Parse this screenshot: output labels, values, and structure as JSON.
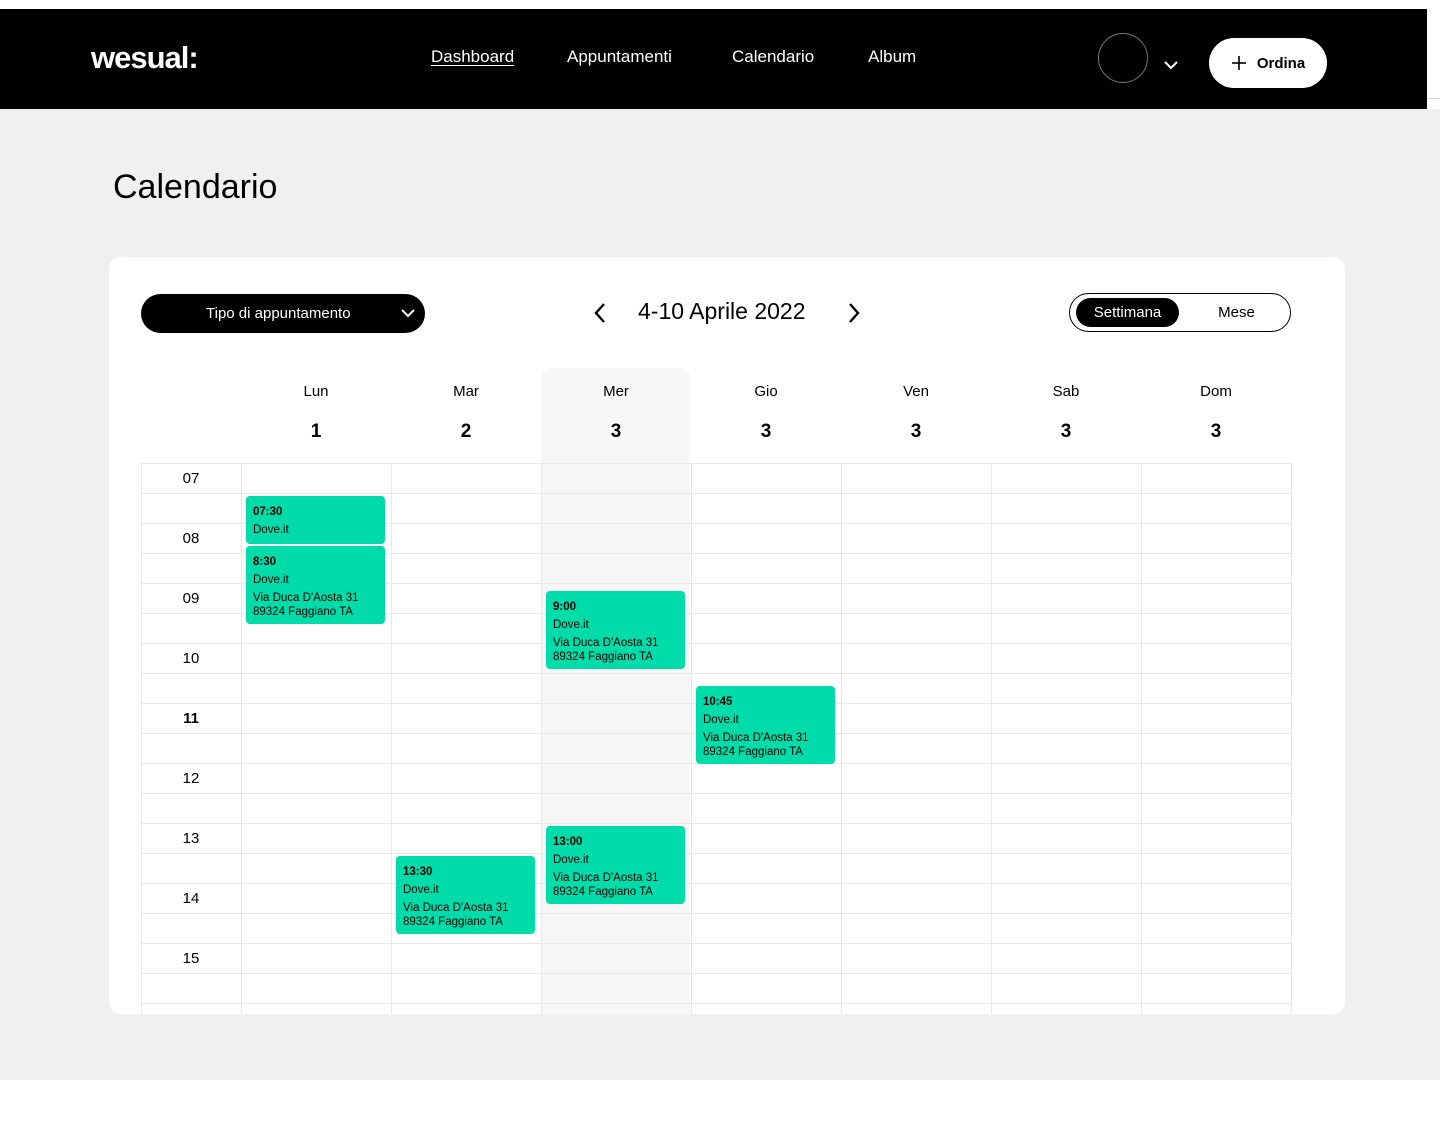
{
  "app": {
    "logo": "wesual:",
    "nav": [
      {
        "label": "Dashboard",
        "active": true
      },
      {
        "label": "Appuntamenti",
        "active": false
      },
      {
        "label": "Calendario",
        "active": false
      },
      {
        "label": "Album",
        "active": false
      }
    ],
    "order_label": "Ordina",
    "accent": "#00dca9"
  },
  "page": {
    "title": "Calendario"
  },
  "toolbar": {
    "type_select": "Tipo di appuntamento",
    "week_label": "4-10 Aprile 2022",
    "view_week": "Settimana",
    "view_month": "Mese"
  },
  "days": [
    {
      "name": "Lun",
      "num": "1"
    },
    {
      "name": "Mar",
      "num": "2"
    },
    {
      "name": "Mer",
      "num": "3",
      "today": true
    },
    {
      "name": "Gio",
      "num": "3"
    },
    {
      "name": "Ven",
      "num": "3"
    },
    {
      "name": "Sab",
      "num": "3"
    },
    {
      "name": "Dom",
      "num": "3"
    }
  ],
  "hours": [
    "07",
    "08",
    "09",
    "10",
    "11",
    "12",
    "13",
    "14",
    "15"
  ],
  "events": [
    {
      "day": 0,
      "start": "07:30",
      "end": "08:20",
      "time": "07:30",
      "place": "Dove.it",
      "address": ""
    },
    {
      "day": 0,
      "start": "08:20",
      "end": "09:40",
      "time": "8:30",
      "place": "Dove.it",
      "address": "Via Duca D'Aosta 31 89324 Faggiano TA"
    },
    {
      "day": 2,
      "start": "09:05",
      "end": "10:25",
      "time": "9:00",
      "place": "Dove.it",
      "address": "Via Duca D'Aosta 31 89324 Faggiano TA"
    },
    {
      "day": 3,
      "start": "10:40",
      "end": "12:00",
      "time": "10:45",
      "place": "Dove.it",
      "address": "Via Duca D'Aosta 31 89324 Faggiano TA"
    },
    {
      "day": 1,
      "start": "13:30",
      "end": "14:50",
      "time": "13:30",
      "place": "Dove.it",
      "address": "Via Duca D'Aosta 31 89324 Faggiano TA"
    },
    {
      "day": 2,
      "start": "13:00",
      "end": "14:20",
      "time": "13:00",
      "place": "Dove.it",
      "address": "Via Duca D'Aosta 31 89324 Faggiano TA"
    }
  ]
}
